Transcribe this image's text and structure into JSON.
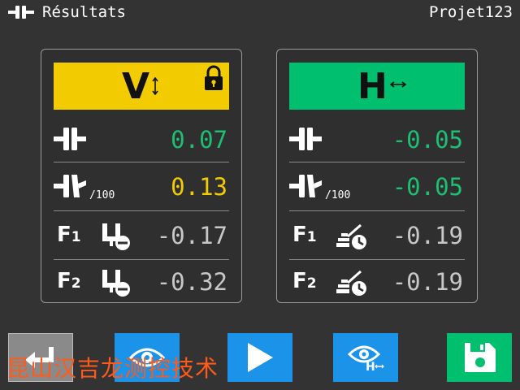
{
  "header": {
    "title": "Résultats",
    "project": "Projet123"
  },
  "panels": [
    {
      "id": "vertical",
      "letter": "V",
      "color": "#f2cc00",
      "locked": true,
      "rows": [
        {
          "icon": "coupling-icon",
          "sub": "",
          "value": "0.07",
          "color": "#1fbf73"
        },
        {
          "icon": "angular-coupling-icon",
          "sub": "/100",
          "value": "0.13",
          "color": "#f2cc00"
        },
        {
          "label": "F",
          "num": "1",
          "icon": "foot-remove-icon",
          "value": "-0.17",
          "color": "#c8c8c8"
        },
        {
          "label": "F",
          "num": "2",
          "icon": "foot-remove-icon",
          "value": "-0.32",
          "color": "#c8c8c8"
        }
      ]
    },
    {
      "id": "horizontal",
      "letter": "H",
      "color": "#00bf6f",
      "locked": false,
      "rows": [
        {
          "icon": "coupling-icon",
          "sub": "",
          "value": "-0.05",
          "color": "#1fbf73"
        },
        {
          "icon": "angular-coupling-icon",
          "sub": "/100",
          "value": "-0.05",
          "color": "#1fbf73"
        },
        {
          "label": "F",
          "num": "1",
          "icon": "foot-adjust-icon",
          "value": "-0.19",
          "color": "#c8c8c8"
        },
        {
          "label": "F",
          "num": "2",
          "icon": "foot-adjust-icon",
          "value": "-0.19",
          "color": "#c8c8c8"
        }
      ]
    }
  ],
  "toolbar": {
    "buttons": [
      "back-button",
      "view-vertical-button",
      "play-button",
      "view-horizontal-button",
      "save-button"
    ],
    "view_h_letter": "H"
  },
  "watermark": "昆山汉吉龙测控技术"
}
